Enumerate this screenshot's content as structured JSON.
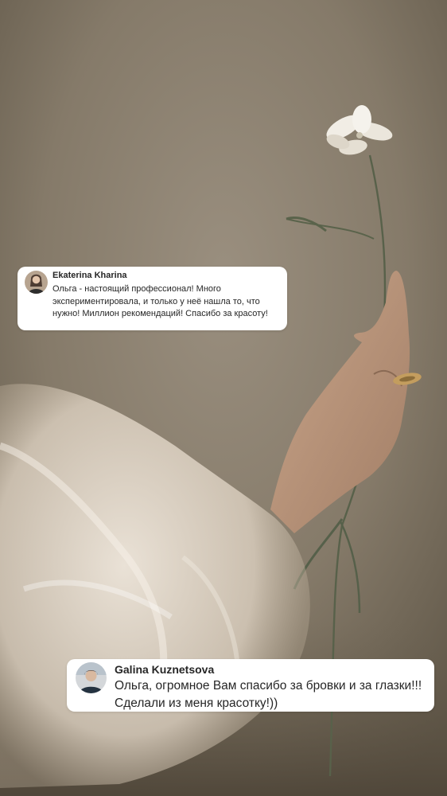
{
  "comments": [
    {
      "author": "Ekaterina Kharina",
      "text": "Ольга - настоящий профессионал! Много экспериментировала, и только у неё нашла то, что нужно! Миллион рекомендаций! Спасибо за красоту!"
    },
    {
      "author": "Galina Kuznetsova",
      "text": "Ольга, огромное Вам спасибо за бровки и за глазки!!! Сделали из меня красотку!))"
    }
  ],
  "colors": {
    "background": "#867c6c",
    "card": "#ffffff",
    "text": "#262626"
  }
}
